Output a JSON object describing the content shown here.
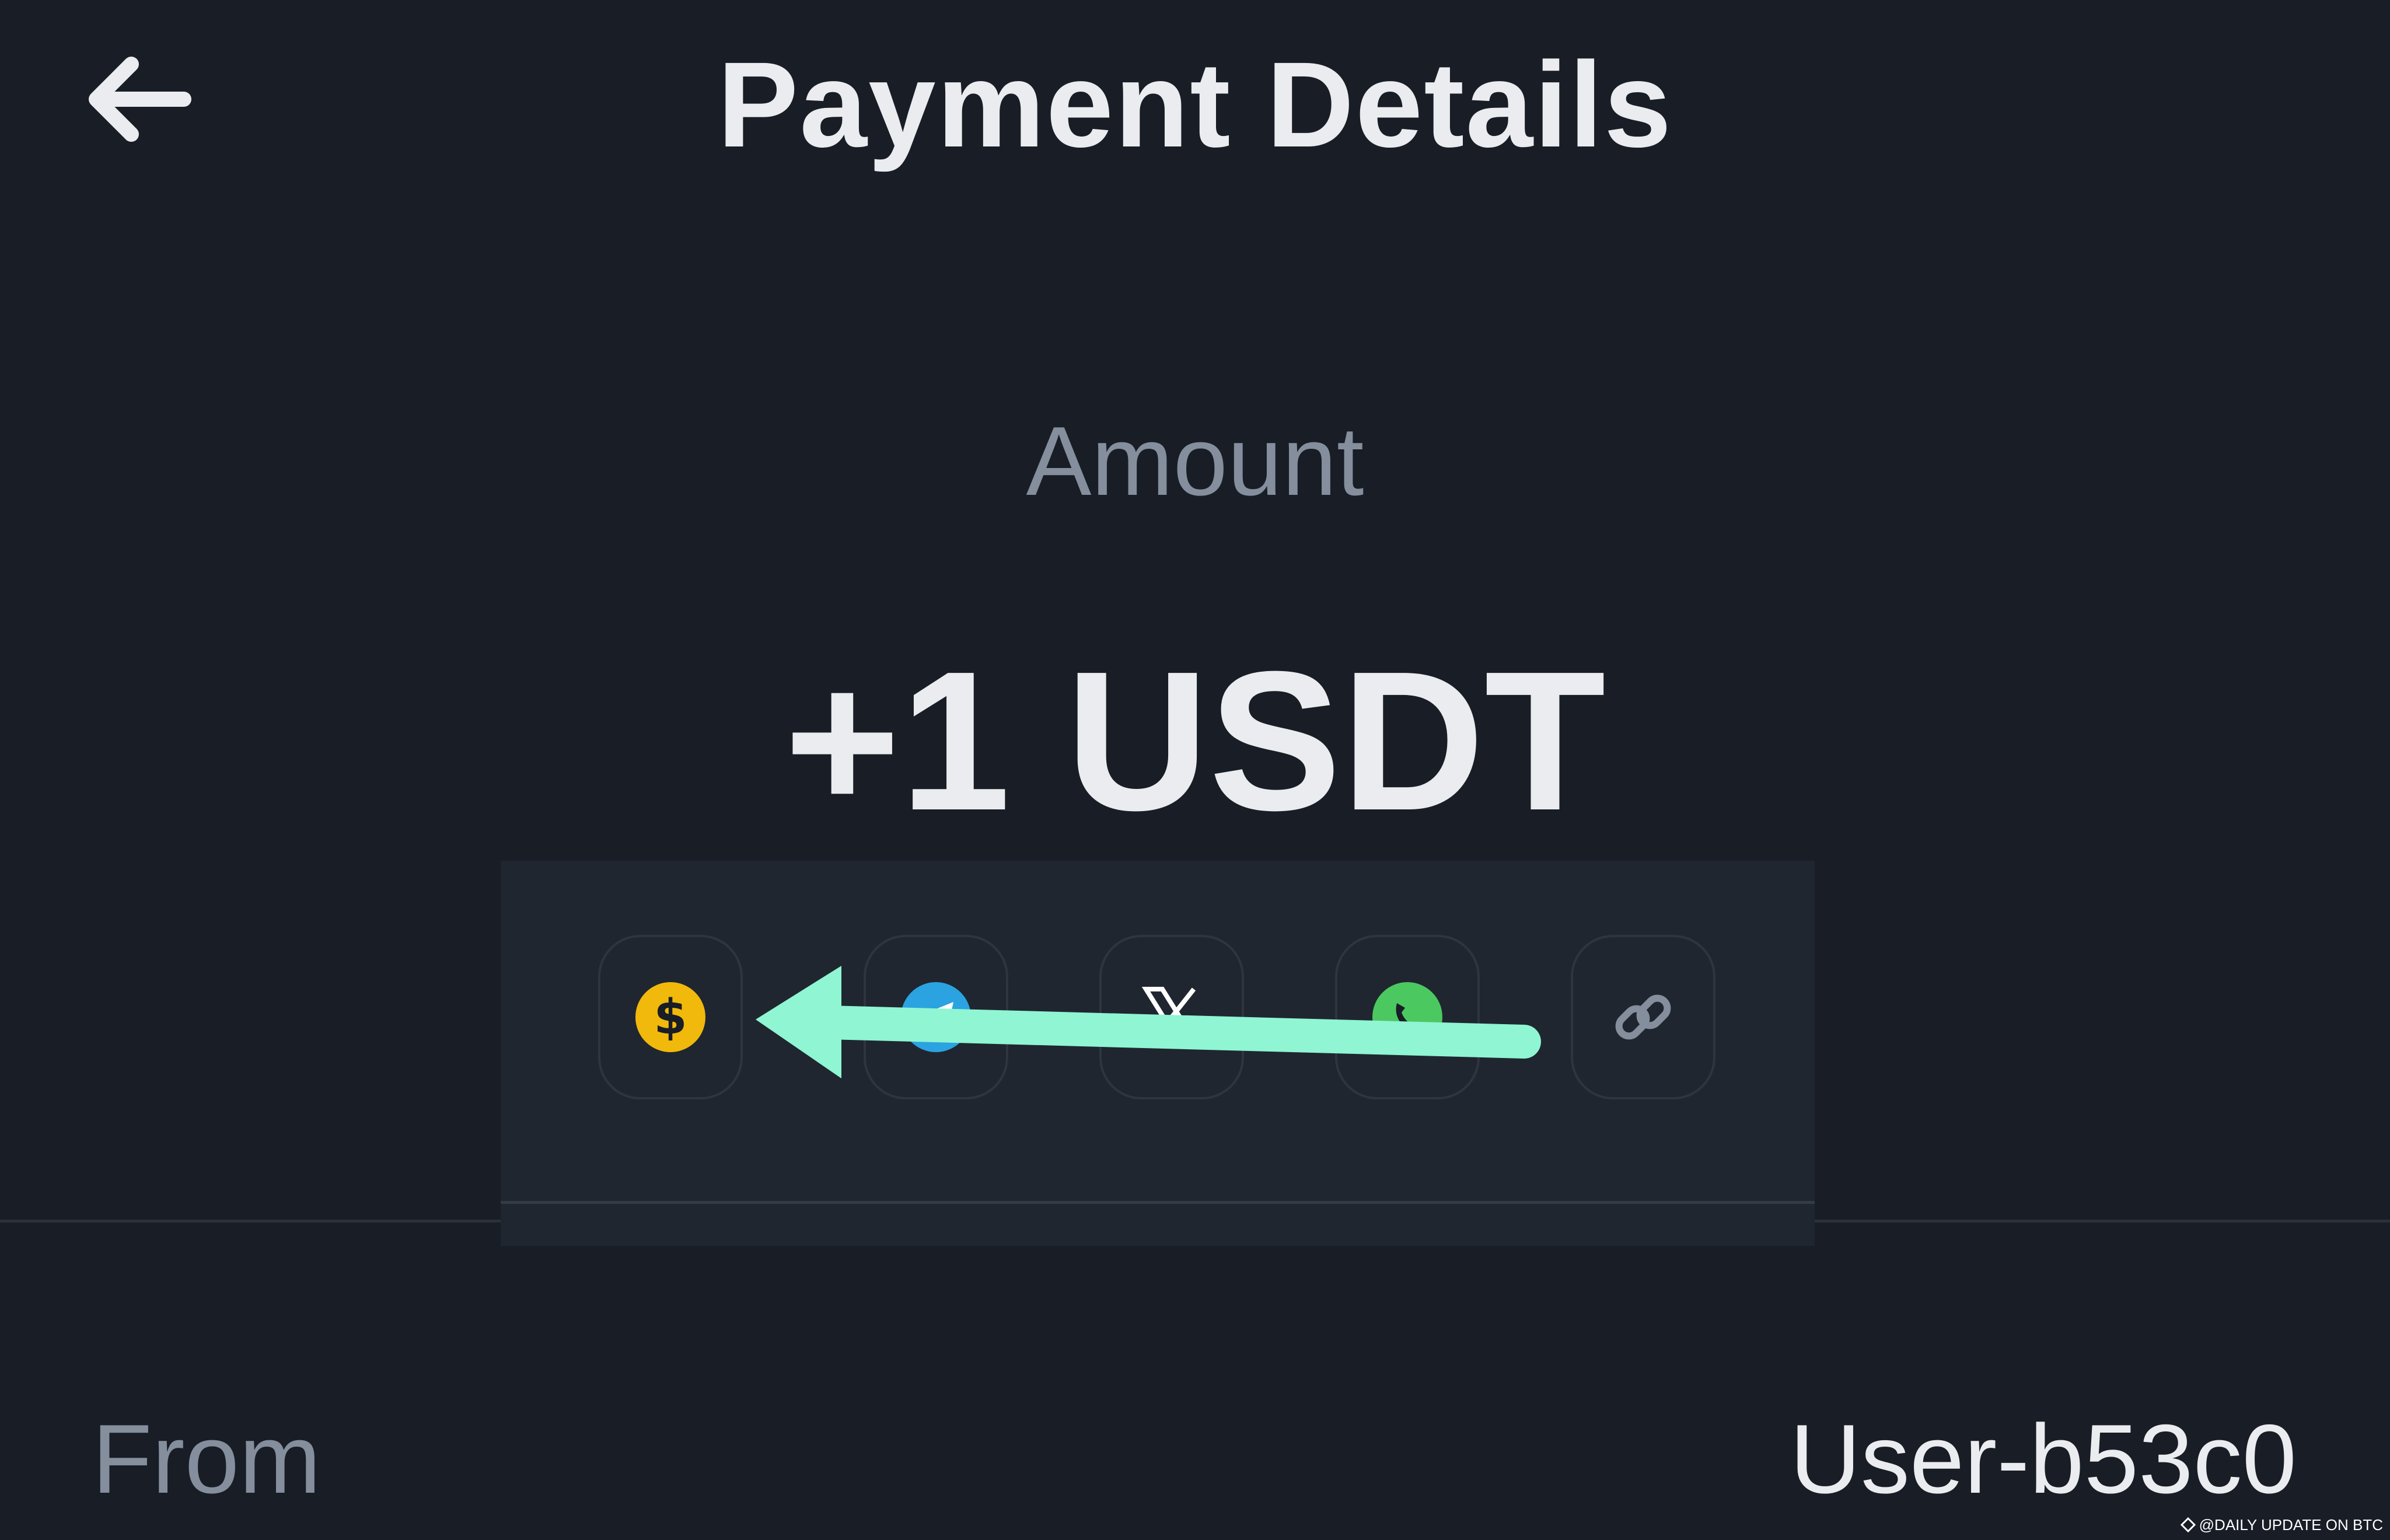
{
  "header": {
    "back_icon": "arrow-left-icon",
    "title": "Payment Details"
  },
  "amount": {
    "label": "Amount",
    "value": "+1 USDT"
  },
  "share_sheet": {
    "icons": [
      {
        "name": "dollar-coin-icon",
        "color": "#f0b90b"
      },
      {
        "name": "telegram-icon",
        "color": "#2aa3e0"
      },
      {
        "name": "x-twitter-icon",
        "color": "#ffffff"
      },
      {
        "name": "whatsapp-icon",
        "color": "#4cc860"
      },
      {
        "name": "link-icon",
        "color": "#848e9c"
      }
    ]
  },
  "annotation": {
    "arrow_color": "#8ff5d2",
    "direction": "left"
  },
  "details": {
    "from_label": "From",
    "from_value": "User-b53c0"
  },
  "watermark": {
    "text": "@DAILY UPDATE ON BTC"
  },
  "colors": {
    "background": "#181d26",
    "primary_text": "#eaecef",
    "secondary_text": "#848e9c"
  }
}
